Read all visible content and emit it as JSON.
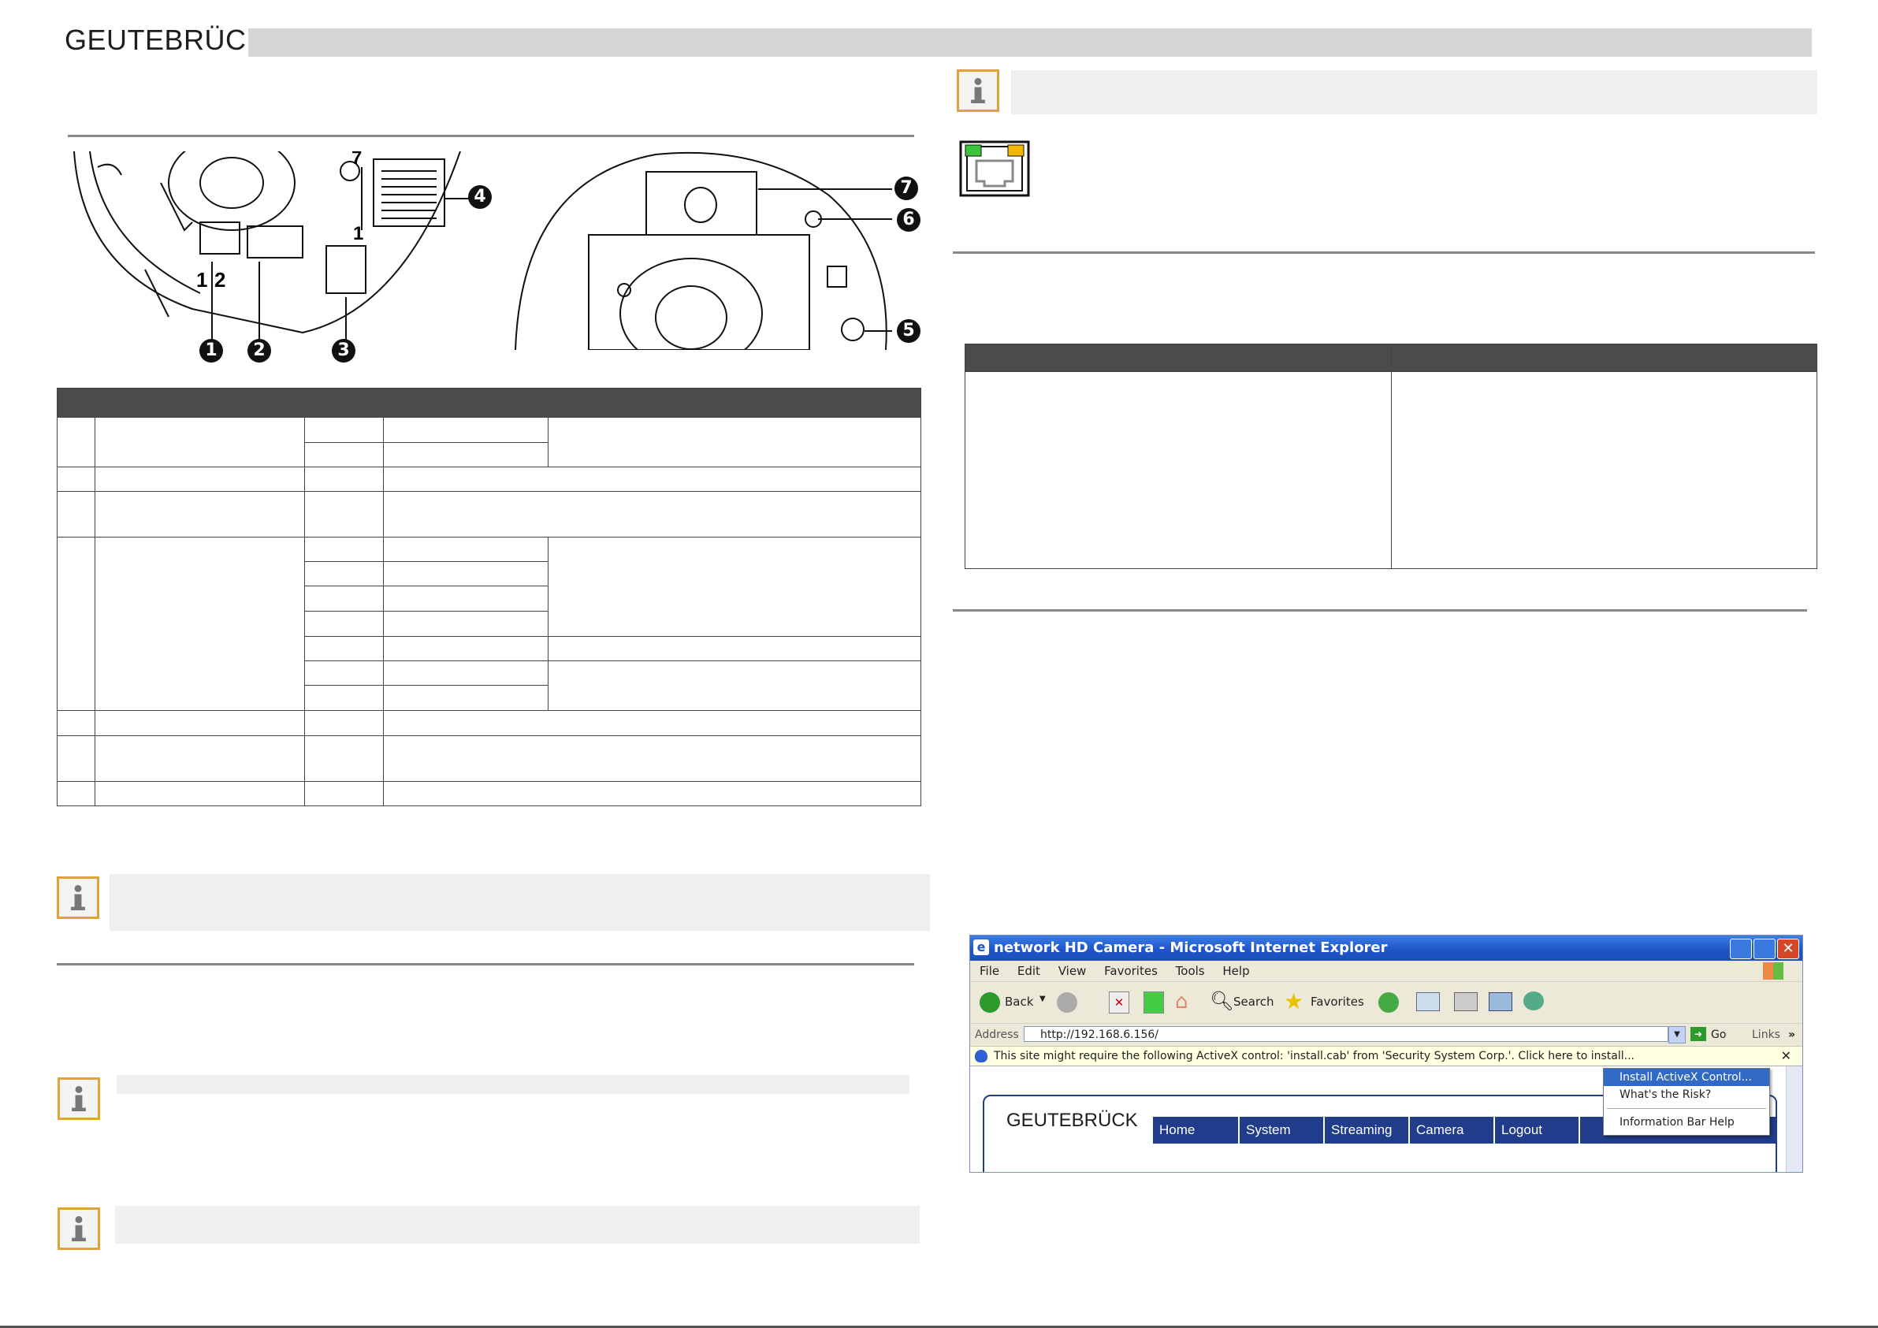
{
  "header": {
    "logo_text": "GEUTEBRÜCK"
  },
  "diagram": {
    "callouts": [
      "1",
      "2",
      "3",
      "4",
      "5",
      "6",
      "7"
    ],
    "connector_pin_labels": [
      "1",
      "2"
    ],
    "terminal_labels": [
      "7",
      "1"
    ]
  },
  "ie_window": {
    "title": "network HD Camera - Microsoft Internet Explorer",
    "menu": [
      "File",
      "Edit",
      "View",
      "Favorites",
      "Tools",
      "Help"
    ],
    "toolbar": {
      "back": "Back",
      "search": "Search",
      "favorites": "Favorites"
    },
    "address_label": "Address",
    "address_value": "http://192.168.6.156/",
    "go_label": "Go",
    "links_label": "Links",
    "infobar_text": "This site might require the following ActiveX control: 'install.cab' from 'Security System Corp.'. Click here to install...",
    "context_menu": [
      "Install ActiveX Control...",
      "What's the Risk?",
      "Information Bar Help"
    ],
    "page_logo": "GEUTEBRÜCK",
    "nav_tabs": [
      "Home",
      "System",
      "Streaming",
      "Camera",
      "Logout"
    ]
  },
  "colors": {
    "info_border": "#e0a23a",
    "table_header": "#4b4b4b",
    "ie_title_blue": "#1f55c8",
    "nav_blue": "#203c8a",
    "lan_green": "#3cc43c",
    "lan_yellow": "#f2b800"
  }
}
